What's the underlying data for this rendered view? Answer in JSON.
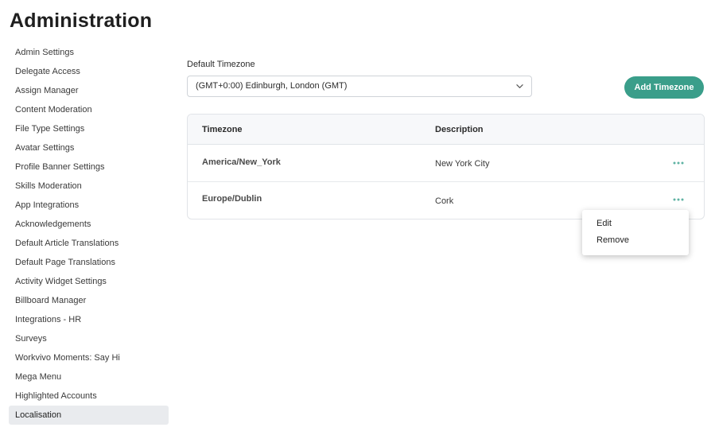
{
  "page": {
    "title": "Administration"
  },
  "sidebar": {
    "items": [
      {
        "label": "Admin Settings"
      },
      {
        "label": "Delegate Access"
      },
      {
        "label": "Assign Manager"
      },
      {
        "label": "Content Moderation"
      },
      {
        "label": "File Type Settings"
      },
      {
        "label": "Avatar Settings"
      },
      {
        "label": "Profile Banner Settings"
      },
      {
        "label": "Skills Moderation"
      },
      {
        "label": "App Integrations"
      },
      {
        "label": "Acknowledgements"
      },
      {
        "label": "Default Article Translations"
      },
      {
        "label": "Default Page Translations"
      },
      {
        "label": "Activity Widget Settings"
      },
      {
        "label": "Billboard Manager"
      },
      {
        "label": "Integrations - HR"
      },
      {
        "label": "Surveys"
      },
      {
        "label": "Workvivo Moments: Say Hi"
      },
      {
        "label": "Mega Menu"
      },
      {
        "label": "Highlighted Accounts"
      },
      {
        "label": "Localisation",
        "active": true
      }
    ]
  },
  "timezone": {
    "label": "Default Timezone",
    "selected": "(GMT+0:00) Edinburgh, London (GMT)",
    "add_button": "Add Timezone"
  },
  "table": {
    "headers": [
      "Timezone",
      "Description"
    ],
    "rows": [
      {
        "timezone": "America/New_York",
        "description": "New York City"
      },
      {
        "timezone": "Europe/Dublin",
        "description": "Cork"
      }
    ]
  },
  "context_menu": {
    "items": [
      "Edit",
      "Remove"
    ]
  },
  "colors": {
    "accent": "#3a9e8a",
    "active_sidebar_bg": "#e9ebee",
    "more_icon": "#5fb3a3"
  },
  "icons": {
    "select": "chevron-down-icon",
    "row_actions": "more-horizontal-icon"
  }
}
